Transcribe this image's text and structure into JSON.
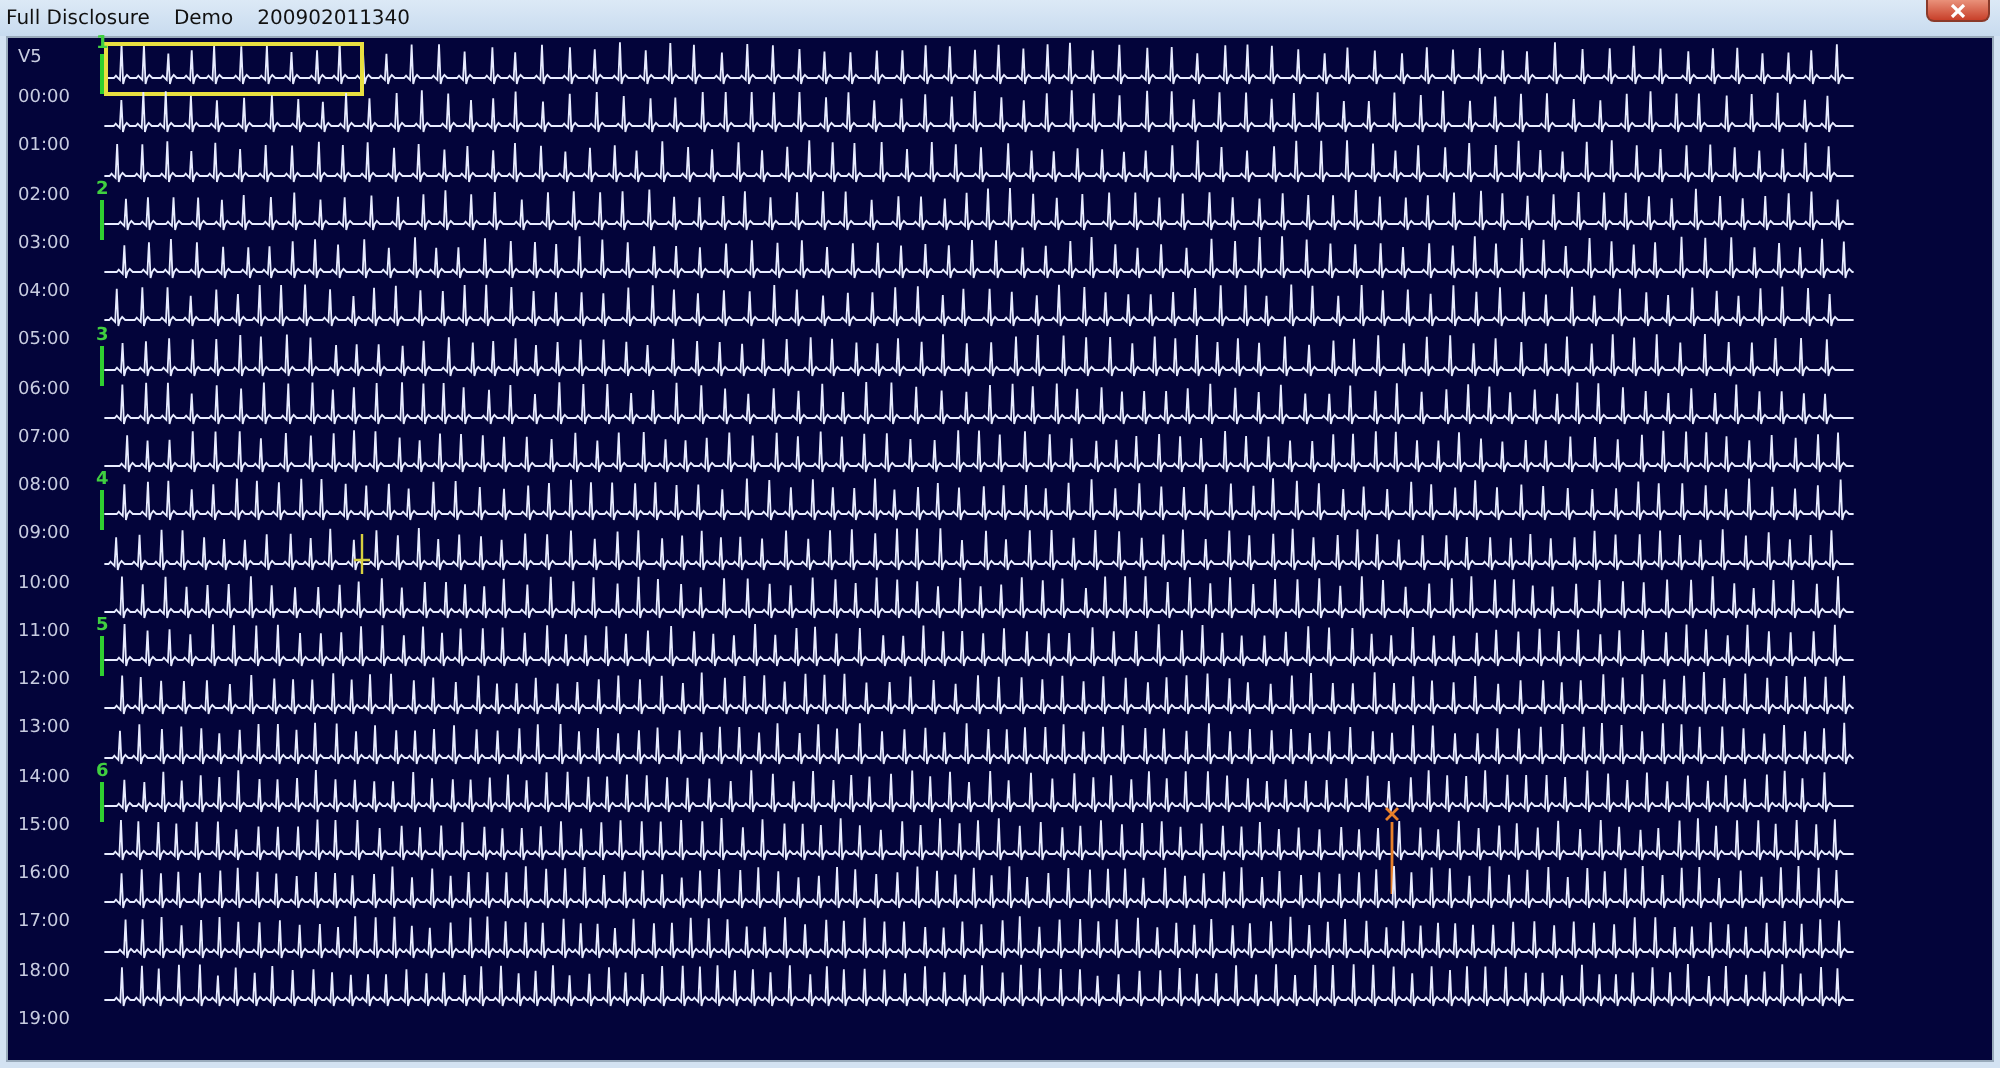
{
  "window": {
    "title": [
      "Full Disclosure",
      "Demo",
      "200902011340"
    ]
  },
  "lead": "V5",
  "rows": [
    {
      "time": "00:00",
      "selected": true,
      "marker": "1"
    },
    {
      "time": "01:00",
      "selected": false
    },
    {
      "time": "02:00",
      "selected": false
    },
    {
      "time": "03:00",
      "selected": false,
      "marker": "2"
    },
    {
      "time": "04:00",
      "selected": false
    },
    {
      "time": "05:00",
      "selected": false
    },
    {
      "time": "06:00",
      "selected": false,
      "marker": "3"
    },
    {
      "time": "07:00",
      "selected": false
    },
    {
      "time": "08:00",
      "selected": false
    },
    {
      "time": "09:00",
      "selected": false,
      "marker": "4"
    },
    {
      "time": "10:00",
      "selected": false,
      "event": {
        "kind": "cursor"
      }
    },
    {
      "time": "11:00",
      "selected": false
    },
    {
      "time": "12:00",
      "selected": false,
      "marker": "5"
    },
    {
      "time": "13:00",
      "selected": false
    },
    {
      "time": "14:00",
      "selected": false
    },
    {
      "time": "15:00",
      "selected": false,
      "marker": "6"
    },
    {
      "time": "16:00",
      "selected": false,
      "event": {
        "kind": "cross"
      }
    },
    {
      "time": "17:00",
      "selected": false
    },
    {
      "time": "18:00",
      "selected": false
    },
    {
      "time": "19:00",
      "selected": false
    }
  ]
}
